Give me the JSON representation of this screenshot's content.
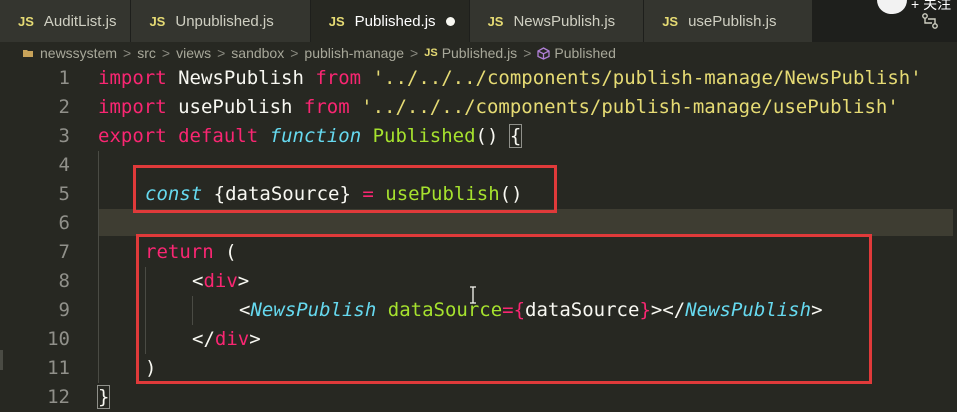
{
  "tabs": [
    {
      "type_label": "JS",
      "name": "AuditList.js",
      "active": false,
      "modified": false
    },
    {
      "type_label": "JS",
      "name": "Unpublished.js",
      "active": false,
      "modified": false
    },
    {
      "type_label": "JS",
      "name": "Published.js",
      "active": true,
      "modified": true
    },
    {
      "type_label": "JS",
      "name": "NewsPublish.js",
      "active": false,
      "modified": false
    },
    {
      "type_label": "JS",
      "name": "usePublish.js",
      "active": false,
      "modified": false
    }
  ],
  "top_right": {
    "follow_label": "+ 关注",
    "icon": "compare-changes-icon"
  },
  "breadcrumb": {
    "items": [
      "newssystem",
      "src",
      "views",
      "sandbox",
      "publish-manage"
    ],
    "file_type": "JS",
    "file": "Published.js",
    "symbol": "Published",
    "separator": ">"
  },
  "editor": {
    "line_numbers": [
      "1",
      "2",
      "3",
      "4",
      "5",
      "6",
      "7",
      "8",
      "9",
      "10",
      "11",
      "12"
    ],
    "tokens": {
      "l1": [
        "import",
        " NewsPublish ",
        "from",
        " '../../../components/publish-manage/NewsPublish'"
      ],
      "l2": [
        "import",
        " usePublish ",
        "from",
        " '../../../components/publish-manage/usePublish'"
      ],
      "l3": [
        "export",
        " ",
        "default",
        " ",
        "function",
        " ",
        "Published",
        "()",
        " ",
        "{"
      ],
      "l5": [
        "const",
        " {dataSource} ",
        "=",
        " ",
        "usePublish",
        "()"
      ],
      "l7": [
        "return",
        " ("
      ],
      "l8": [
        "<",
        "div",
        ">"
      ],
      "l9": [
        "<",
        "NewsPublish",
        " ",
        "dataSource",
        "=",
        "{",
        "dataSource",
        "}",
        "></",
        "NewsPublish",
        ">"
      ],
      "l10": [
        "</",
        "div",
        ">"
      ],
      "l11": [
        ")"
      ],
      "l12": [
        "}"
      ]
    }
  },
  "colors": {
    "background": "#272822",
    "keyword": "#f92672",
    "storage_italic": "#66d9ef",
    "function": "#a6e22e",
    "string": "#e6db74",
    "plain": "#f8f8f2",
    "annotation_box": "#e03a3a"
  }
}
